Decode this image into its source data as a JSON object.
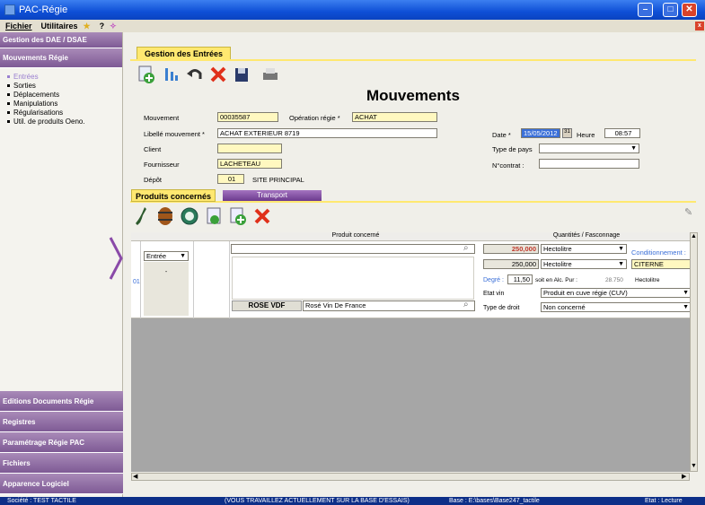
{
  "window": {
    "title": "PAC-Régie"
  },
  "menu": {
    "items": [
      "Fichier",
      "Utilitaires",
      "?"
    ]
  },
  "sidebar": {
    "top_sections": [
      "Gestion des DAE / DSAE",
      "Mouvements Régie"
    ],
    "items": [
      {
        "label": "Entrées",
        "active": true
      },
      {
        "label": "Sorties",
        "active": false
      },
      {
        "label": "Déplacements",
        "active": false
      },
      {
        "label": "Manipulations",
        "active": false
      },
      {
        "label": "Régularisations",
        "active": false
      },
      {
        "label": "Util. de produits Oeno.",
        "active": false
      }
    ],
    "bottom_sections": [
      "Editions Documents Régie",
      "Registres",
      "Paramétrage Régie PAC",
      "Fichiers",
      "Apparence Logiciel"
    ]
  },
  "main": {
    "tab": "Gestion des Entrées",
    "heading": "Mouvements",
    "form": {
      "mouvement_label": "Mouvement",
      "mouvement_value": "00035587",
      "operation_label": "Opération régie *",
      "operation_value": "ACHAT",
      "libelle_label": "Libellé mouvement *",
      "libelle_value": "ACHAT EXTERIEUR 8719",
      "client_label": "Client",
      "client_value": "",
      "fournisseur_label": "Fournisseur",
      "fournisseur_value": "LACHETEAU",
      "depot_label": "Dépôt",
      "depot_code": "01",
      "depot_name": "SITE PRINCIPAL",
      "date_label": "Date *",
      "date_value": "15/05/2012",
      "heure_label": "Heure",
      "heure_value": "08:57",
      "type_pays_label": "Type de pays",
      "type_pays_value": "",
      "ncontrat_label": "N°contrat :",
      "ncontrat_value": ""
    },
    "subtabs": [
      "Produits concernés",
      "Transport"
    ],
    "grid": {
      "headers": [
        "Produit concerné",
        "Quantités / Fasconnage"
      ],
      "row_number": "01",
      "sens": "Entrée",
      "sens_sub": "-",
      "produit_search": "",
      "produit_code": "ROSE VDF",
      "produit_name": "Rosé Vin De France",
      "qty1": "250,000",
      "unit1": "Hectolitre",
      "qty2": "250,000",
      "unit2": "Hectolitre",
      "conditionnement_label": "Conditionnement :",
      "conditionnement_value": "CITERNE",
      "degre_label": "Degré :",
      "degre_value": "11,50",
      "alc_label": "soit en Alc. Pur :",
      "alc_value": "28.750",
      "alc_unit": "Hectolitre",
      "etat_label": "Etat vin",
      "etat_value": "Produit en cuve régie (CUV)",
      "droit_label": "Type de droit",
      "droit_value": "Non concerné"
    }
  },
  "status": {
    "societe": "Société : TEST TACTILE",
    "message": "(VOUS TRAVAILLEZ ACTUELLEMENT SUR LA BASE D'ESSAIS)",
    "base": "Base : E:\\bases\\Base247_tactile",
    "etat": "Etat : Lecture"
  }
}
